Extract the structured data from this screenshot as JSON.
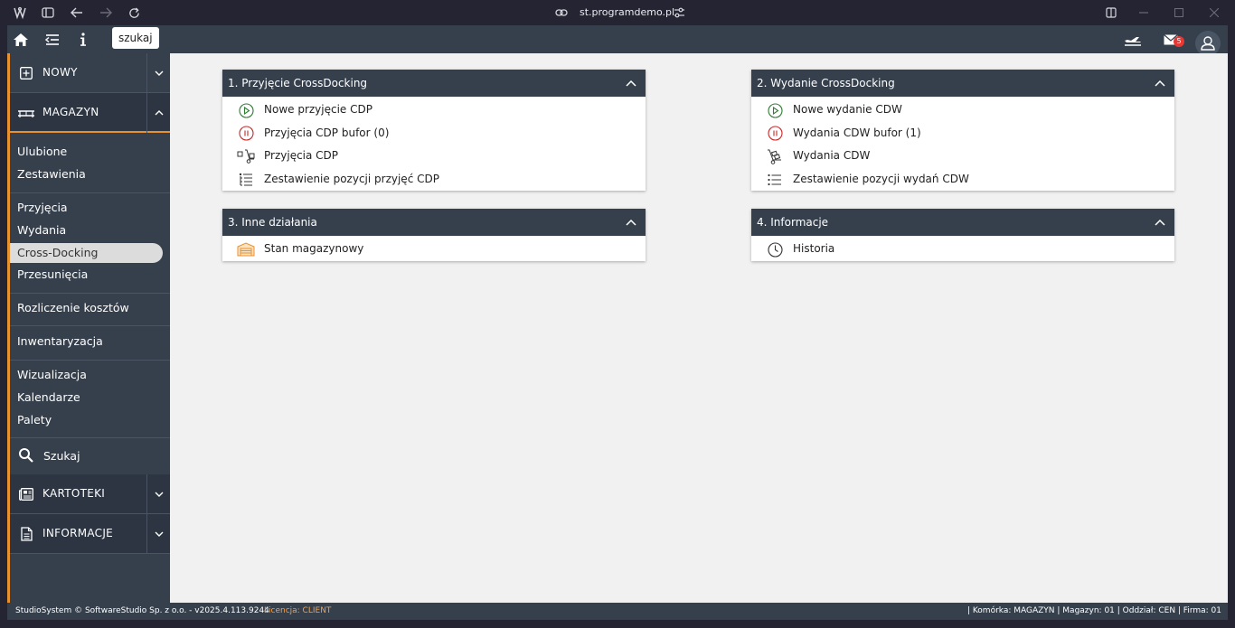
{
  "browser": {
    "url": "st.programdemo.pl"
  },
  "topbar": {
    "search_chip": "szukaj",
    "mail_count": "5"
  },
  "sidebar": {
    "nowy": "NOWY",
    "magazyn": "MAGAZYN",
    "items": [
      {
        "label": "Ulubione"
      },
      {
        "label": "Zestawienia"
      },
      {
        "label": "Przyjęcia"
      },
      {
        "label": "Wydania"
      },
      {
        "label": "Cross-Docking"
      },
      {
        "label": "Przesunięcia"
      },
      {
        "label": "Rozliczenie kosztów"
      },
      {
        "label": "Inwentaryzacja"
      },
      {
        "label": "Wizualizacja"
      },
      {
        "label": "Kalendarze"
      },
      {
        "label": "Palety"
      }
    ],
    "szukaj": "Szukaj",
    "kartoteki": "KARTOTEKI",
    "informacje": "INFORMACJE"
  },
  "cards": [
    {
      "title": "1. Przyjęcie CrossDocking",
      "rows": [
        "Nowe przyjęcie CDP",
        "Przyjęcia CDP bufor (0)",
        "Przyjęcia CDP",
        "Zestawienie pozycji przyjęć CDP"
      ]
    },
    {
      "title": "2. Wydanie CrossDocking",
      "rows": [
        "Nowe wydanie CDW",
        "Wydania CDW bufor (1)",
        "Wydania CDW",
        "Zestawienie pozycji wydań CDW"
      ]
    },
    {
      "title": "3. Inne działania",
      "rows": [
        "Stan magazynowy"
      ]
    },
    {
      "title": "4. Informacje",
      "rows": [
        "Historia"
      ]
    }
  ],
  "statusbar": {
    "left": "StudioSystem © SoftwareStudio Sp. z o.o. - v2025.4.113.9244",
    "license": "Licencja: CLIENT",
    "right": "| Komórka: MAGAZYN | Magazyn: 01 | Oddział: CEN | Firma: 01"
  },
  "colors": {
    "accent": "#e8912f",
    "header": "#36404d",
    "badge": "#e53935"
  }
}
